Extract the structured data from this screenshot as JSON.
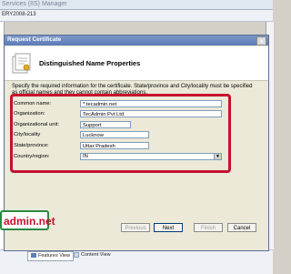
{
  "background_window": {
    "title": "Services (IIS) Manager",
    "address": "ERY2008-213",
    "views": [
      "Features View",
      "Content View"
    ]
  },
  "dialog": {
    "title": "Request Certificate",
    "close_glyph": "x",
    "heading": "Distinguished Name Properties",
    "description": "Specify the required information for the certificate. State/province and City/locality must be specified as official names and they cannot contain abbreviations.",
    "fields": [
      {
        "label": "Common name:",
        "value": "*.tecadmin.net"
      },
      {
        "label": "Organization:",
        "value": "TecAdmin Pvt Ltd"
      },
      {
        "label": "Organizational unit:",
        "value": "Support"
      },
      {
        "label": "City/locality",
        "value": "Lucknow"
      },
      {
        "label": "State/province:",
        "value": "Uttar Pradesh"
      },
      {
        "label": "Country/region:",
        "value": "IN"
      }
    ],
    "buttons": {
      "previous": "Previous",
      "next": "Next",
      "finish": "Finish",
      "cancel": "Cancel"
    }
  },
  "watermark": "admin.net",
  "colors": {
    "highlight_border": "#c8102e",
    "watermark_border": "#2b8a3e",
    "title_bar": "#5c7bb8"
  }
}
